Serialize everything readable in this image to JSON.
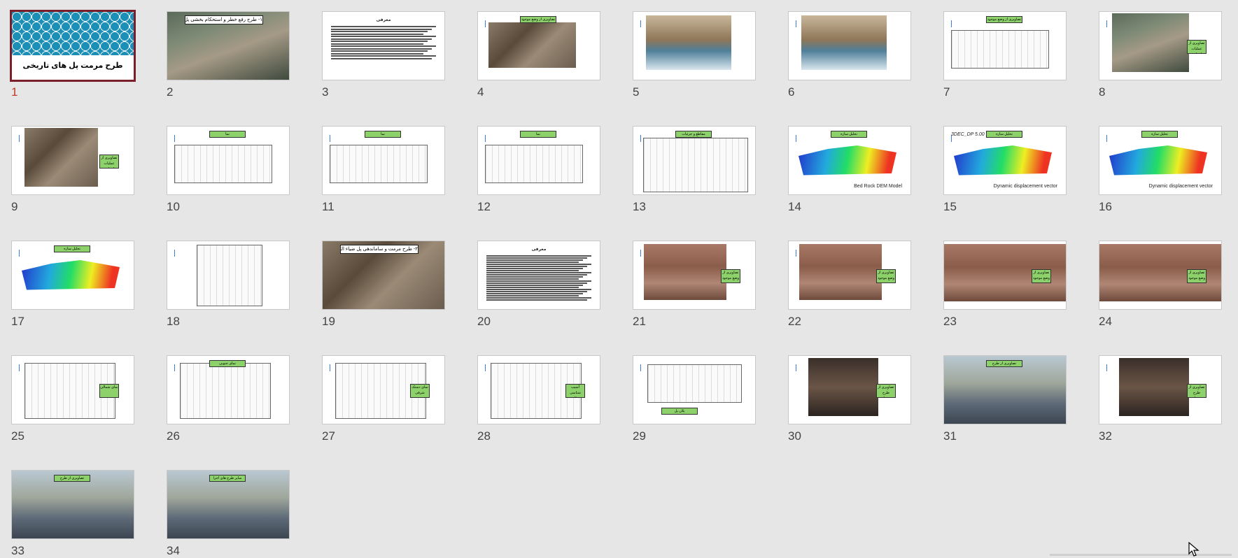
{
  "slides": [
    {
      "n": "1",
      "title": "طرح مرمت پل های تاریخی"
    },
    {
      "n": "2",
      "title": "۱- طرح رفع خطر و استحکام بخشی پل دراکول"
    },
    {
      "n": "3",
      "title": "معرفی"
    },
    {
      "n": "4",
      "label": "تصاویری از وضع موجود پل"
    },
    {
      "n": "5"
    },
    {
      "n": "6"
    },
    {
      "n": "7",
      "label": "تصاویری از وضع موجود پل"
    },
    {
      "n": "8",
      "label": "تصاویری از عملیات اجرایی"
    },
    {
      "n": "9",
      "label": "تصاویری از عملیات اجرایی"
    },
    {
      "n": "10",
      "label": "نما"
    },
    {
      "n": "11",
      "label": "نما"
    },
    {
      "n": "12",
      "label": "نما"
    },
    {
      "n": "13",
      "label": "مقاطع و جزئیات"
    },
    {
      "n": "14",
      "label": "تحلیل سازه",
      "caption": "Bed Rock DEM Model"
    },
    {
      "n": "15",
      "label": "تحلیل سازه",
      "caption": "Dynamic displacement vector",
      "subcaption": "3DEC_DP 5.00"
    },
    {
      "n": "16",
      "label": "تحلیل سازه",
      "caption": "Dynamic displacement vector"
    },
    {
      "n": "17",
      "label": "تحلیل سازه"
    },
    {
      "n": "18"
    },
    {
      "n": "19",
      "title": "۲- طرح مرمت و ساماندهی پل ضیاء الملک"
    },
    {
      "n": "20",
      "title": "معرفی"
    },
    {
      "n": "21",
      "label": "تصاویری از وضع موجود"
    },
    {
      "n": "22",
      "label": "تصاویری از وضع موجود"
    },
    {
      "n": "23",
      "label": "تصاویری از وضع موجود"
    },
    {
      "n": "24",
      "label": "تصاویری از وضع موجود"
    },
    {
      "n": "25",
      "label": "نمای شمالی"
    },
    {
      "n": "26",
      "label": "نمای جنوبی"
    },
    {
      "n": "27",
      "label": "نمای دستک شرقی"
    },
    {
      "n": "28",
      "label": "آسیب شناسی شمالی و جنوبی"
    },
    {
      "n": "29",
      "label": "پلان پل"
    },
    {
      "n": "30",
      "label": "تصاویری از طرح پیشنهادی"
    },
    {
      "n": "31",
      "label": "تصاویری از طرح پیشنهادی"
    },
    {
      "n": "32",
      "label": "تصاویری از طرح پیشنهادی"
    },
    {
      "n": "33",
      "label": "تصاویری از طرح پیشنهادی"
    },
    {
      "n": "34",
      "label": "سایر طرح های اجرا شده"
    }
  ]
}
